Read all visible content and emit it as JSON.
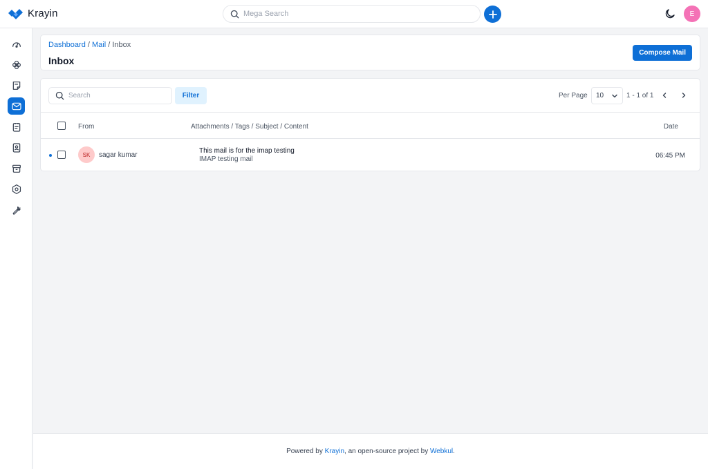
{
  "app": {
    "name": "Krayin"
  },
  "topbar": {
    "search_placeholder": "Mega Search",
    "avatar_initial": "E"
  },
  "sidebar": {
    "items": [
      {
        "icon": "dashboard-icon",
        "active": false
      },
      {
        "icon": "leads-icon",
        "active": false
      },
      {
        "icon": "quotes-icon",
        "active": false
      },
      {
        "icon": "mail-icon",
        "active": true
      },
      {
        "icon": "activities-icon",
        "active": false
      },
      {
        "icon": "contacts-icon",
        "active": false
      },
      {
        "icon": "products-icon",
        "active": false
      },
      {
        "icon": "settings-icon",
        "active": false
      },
      {
        "icon": "configuration-icon",
        "active": false
      }
    ]
  },
  "header": {
    "breadcrumb": {
      "dashboard": "Dashboard",
      "mail": "Mail",
      "current": "Inbox",
      "separator": "/"
    },
    "title": "Inbox",
    "compose_label": "Compose Mail"
  },
  "grid": {
    "search_placeholder": "Search",
    "filter_label": "Filter",
    "per_page_label": "Per Page",
    "per_page_value": "10",
    "page_range": "1 - 1 of 1",
    "columns": {
      "from": "From",
      "content": "Attachments / Tags / Subject / Content",
      "date": "Date"
    },
    "rows": [
      {
        "initials": "SK",
        "from": "sagar kumar",
        "subject": "This mail is for the imap testing",
        "content": "IMAP testing mail",
        "date": "06:45 PM",
        "unread": true
      }
    ]
  },
  "footer": {
    "prefix": "Powered by",
    "brand": "Krayin",
    "middle": ", an open-source project by",
    "company": "Webkul",
    "suffix": "."
  },
  "colors": {
    "primary": "#0e6fd6",
    "avatar_top": "#f472b6",
    "row_avatar": "#fecaca"
  }
}
